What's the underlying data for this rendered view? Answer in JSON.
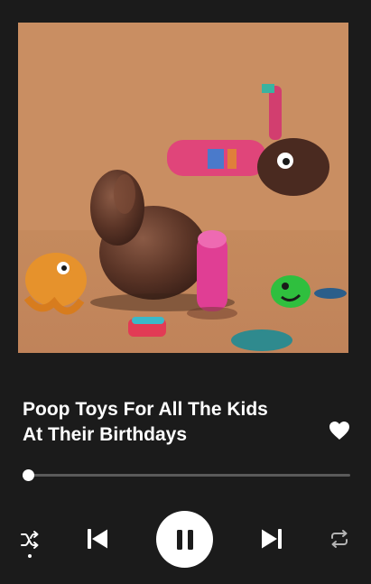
{
  "track": {
    "title_line1": "Poop Toys For All The Kids",
    "title_line2": "At Their Birthdays",
    "liked": true
  },
  "progress": {
    "fraction": 0.014
  },
  "controls": {
    "shuffle": {
      "icon": "shuffle-icon",
      "active": true
    },
    "previous": {
      "icon": "skip-back-icon"
    },
    "play_pause": {
      "icon": "pause-icon",
      "state": "playing"
    },
    "next": {
      "icon": "skip-forward-icon"
    },
    "repeat": {
      "icon": "repeat-icon",
      "active": false
    }
  },
  "colors": {
    "background": "#1b1b1b",
    "accent": "#ffffff",
    "track_bg": "#5a5a5a",
    "inactive_icon": "#b3b3b3"
  }
}
